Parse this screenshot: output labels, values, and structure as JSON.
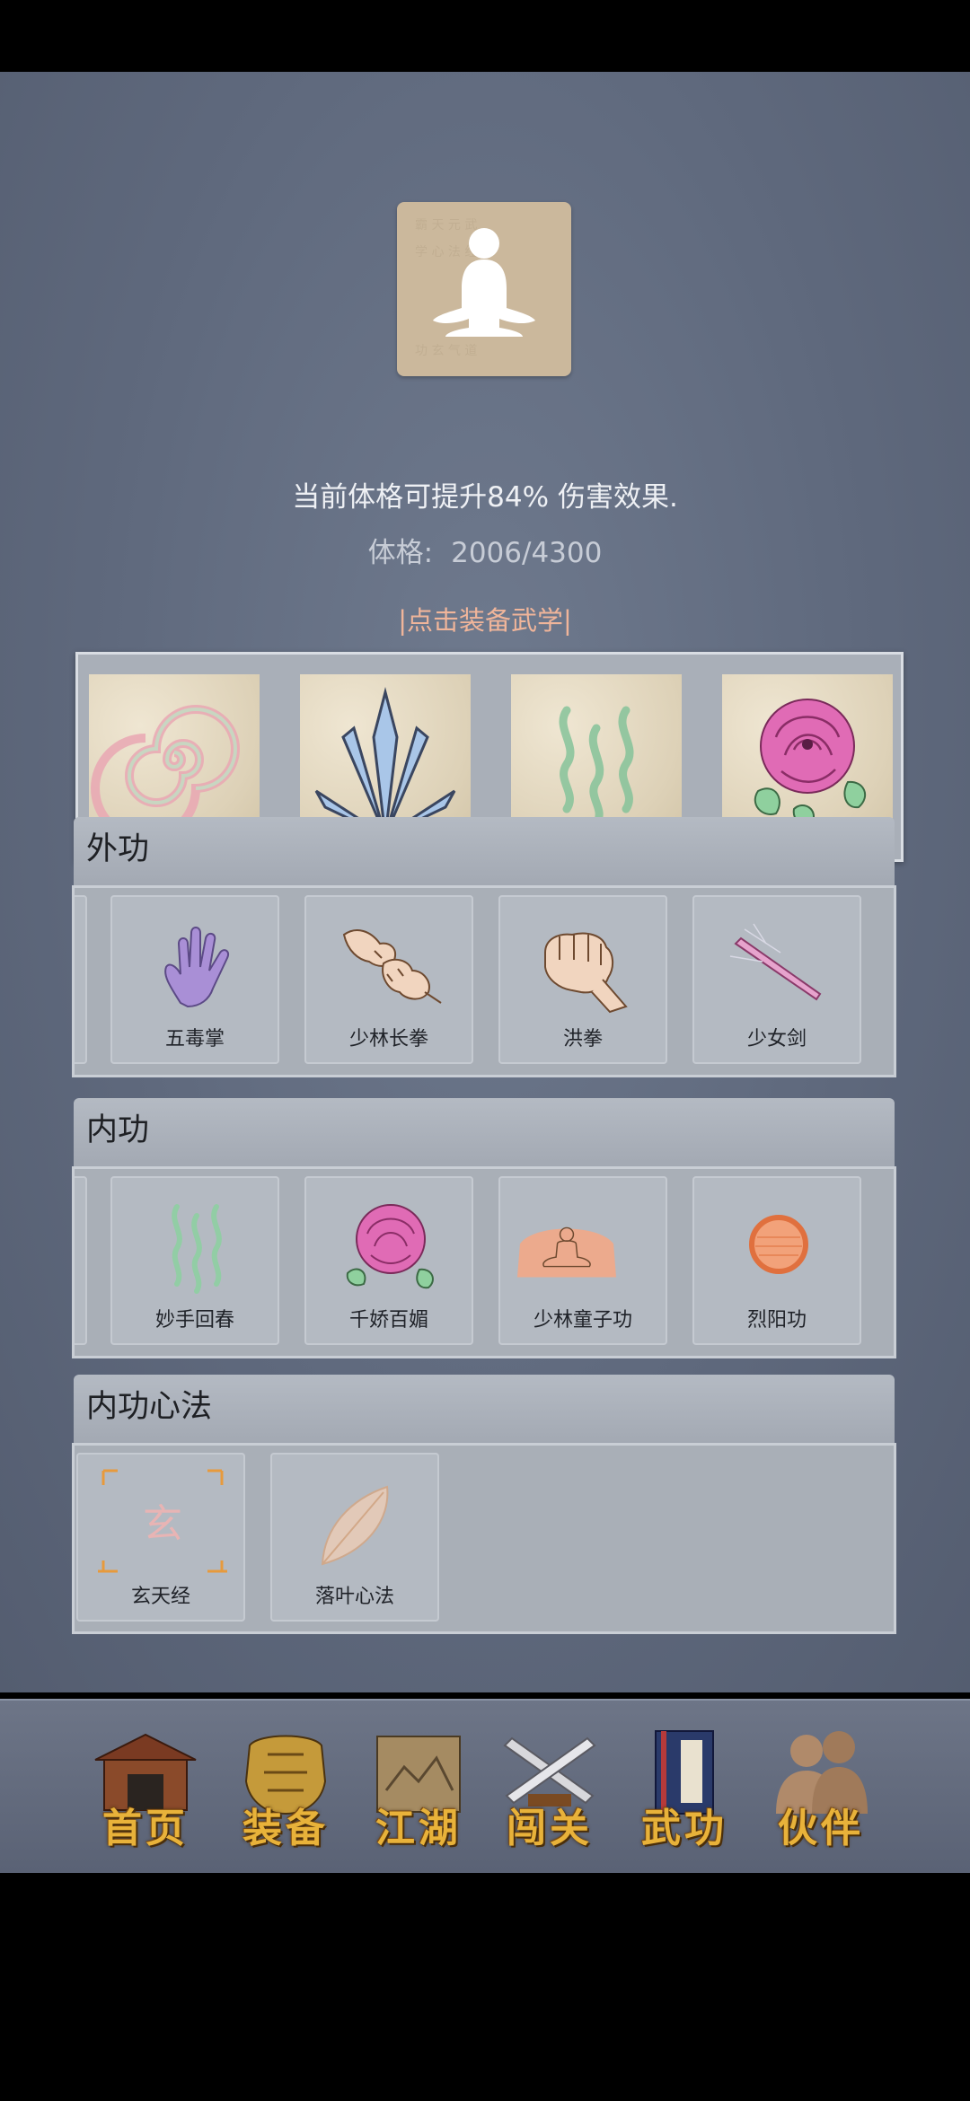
{
  "header": {
    "boost_text": "当前体格可提升84% 伤害效果.",
    "constitution_label": "体格:",
    "constitution_value": "2006/4300",
    "equip_hint": "|点击装备武学|"
  },
  "portrait_icon": "meditation-figure-icon",
  "equipped_slots": [
    {
      "icon": "spiral-icon"
    },
    {
      "icon": "ice-blades-icon"
    },
    {
      "icon": "green-waves-icon"
    },
    {
      "icon": "rose-icon"
    }
  ],
  "sections": {
    "external": {
      "title": "外功",
      "skills": [
        {
          "name": "五毒掌",
          "icon": "purple-hand-icon"
        },
        {
          "name": "少林长拳",
          "icon": "fists-icon"
        },
        {
          "name": "洪拳",
          "icon": "fist-icon"
        },
        {
          "name": "少女剑",
          "icon": "pink-sword-icon"
        }
      ]
    },
    "internal": {
      "title": "内功",
      "skills": [
        {
          "name": "妙手回春",
          "icon": "green-waves-icon"
        },
        {
          "name": "千娇百媚",
          "icon": "rose-icon"
        },
        {
          "name": "少林童子功",
          "icon": "buddha-icon"
        },
        {
          "name": "烈阳功",
          "icon": "fire-orb-icon"
        }
      ]
    },
    "mind": {
      "title": "内功心法",
      "skills": [
        {
          "name": "玄天经",
          "icon": "xuan-scroll-icon"
        },
        {
          "name": "落叶心法",
          "icon": "leaf-icon"
        }
      ]
    }
  },
  "nav": [
    {
      "label": "首页",
      "icon": "temple-icon"
    },
    {
      "label": "装备",
      "icon": "armor-icon"
    },
    {
      "label": "江湖",
      "icon": "map-scroll-icon"
    },
    {
      "label": "闯关",
      "icon": "crossed-swords-icon"
    },
    {
      "label": "武功",
      "icon": "manual-book-icon"
    },
    {
      "label": "伙伴",
      "icon": "companions-icon"
    }
  ],
  "colors": {
    "background": "#5f697d",
    "hint": "#f0b59a",
    "nav_text": "#e8b23a"
  }
}
